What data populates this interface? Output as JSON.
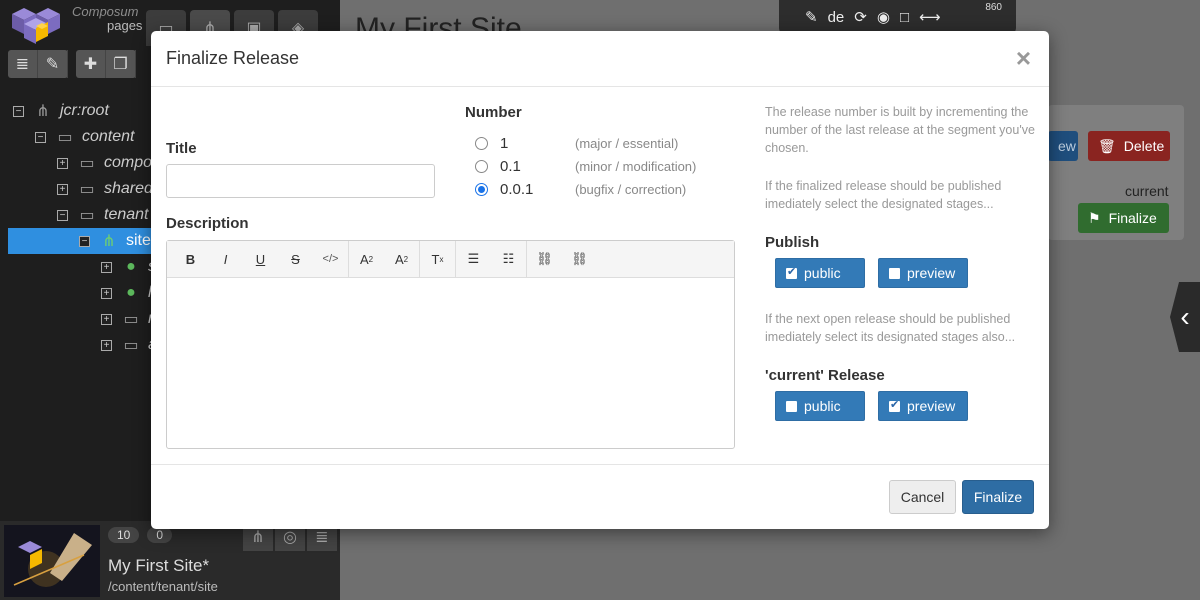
{
  "app": {
    "logo_line1": "Composum",
    "logo_line2": "pages",
    "page_title": "My First Site",
    "language": "de",
    "width_readout": "860",
    "bg_delete_label": "Delete",
    "bg_view_label": "ew",
    "bg_current_label": "current",
    "bg_finalize_label": "Finalize"
  },
  "tree": [
    {
      "label": "jcr:root",
      "level": 0,
      "toggle": "−",
      "icon": "hierarchy-icon"
    },
    {
      "label": "content",
      "level": 1,
      "toggle": "−",
      "icon": "folder-icon"
    },
    {
      "label": "compo",
      "level": 2,
      "toggle": "+",
      "icon": "folder-icon"
    },
    {
      "label": "shared",
      "level": 2,
      "toggle": "+",
      "icon": "folder-icon"
    },
    {
      "label": "tenant",
      "level": 2,
      "toggle": "−",
      "icon": "folder-icon"
    },
    {
      "label": "site",
      "level": 3,
      "toggle": "−",
      "icon": "site-icon",
      "selected": true
    },
    {
      "label": "s",
      "level": 4,
      "toggle": "+",
      "icon": "globe-icon"
    },
    {
      "label": "h",
      "level": 4,
      "toggle": "+",
      "icon": "globe-icon"
    },
    {
      "label": "n",
      "level": 4,
      "toggle": "+",
      "icon": "folder-icon"
    },
    {
      "label": "a",
      "level": 4,
      "toggle": "+",
      "icon": "folder-icon"
    }
  ],
  "bottom_panel": {
    "count1": "10",
    "count2": "0",
    "site_title": "My First Site*",
    "site_path": "/content/tenant/site"
  },
  "modal": {
    "title": "Finalize Release",
    "close_symbol": "×",
    "title_label": "Title",
    "title_value": "",
    "description_label": "Description",
    "number_label": "Number",
    "number_options": [
      {
        "value": "1",
        "hint": "(major / essential)",
        "checked": false
      },
      {
        "value": "0.1",
        "hint": "(minor / modification)",
        "checked": false
      },
      {
        "value": "0.0.1",
        "hint": "(bugfix / correction)",
        "checked": true
      }
    ],
    "info_number": "The release number is built by incrementing the number of the last release at the segment you've chosen.",
    "info_publish": "If the finalized release should be published imediately select the designated stages...",
    "publish_label": "Publish",
    "publish_options": [
      {
        "label": "public",
        "checked": true
      },
      {
        "label": "preview",
        "checked": false
      }
    ],
    "info_current": "If the next open release should be published imediately select its designated stages also...",
    "current_label": "'current' Release",
    "current_options": [
      {
        "label": "public",
        "checked": false
      },
      {
        "label": "preview",
        "checked": true
      }
    ],
    "cancel_label": "Cancel",
    "finalize_label": "Finalize"
  },
  "toolbar_icons": [
    "bold-icon",
    "italic-icon",
    "underline-icon",
    "strikethrough-icon",
    "code-icon",
    "superscript-icon",
    "subscript-icon",
    "clear-format-icon",
    "bulleted-list-icon",
    "numbered-list-icon",
    "link-icon",
    "unlink-icon"
  ],
  "colors": {
    "primary": "#337ab7",
    "selected_tree": "#2f8fe0",
    "delete": "#8a2420",
    "finalize_bg": "#306c2f"
  }
}
